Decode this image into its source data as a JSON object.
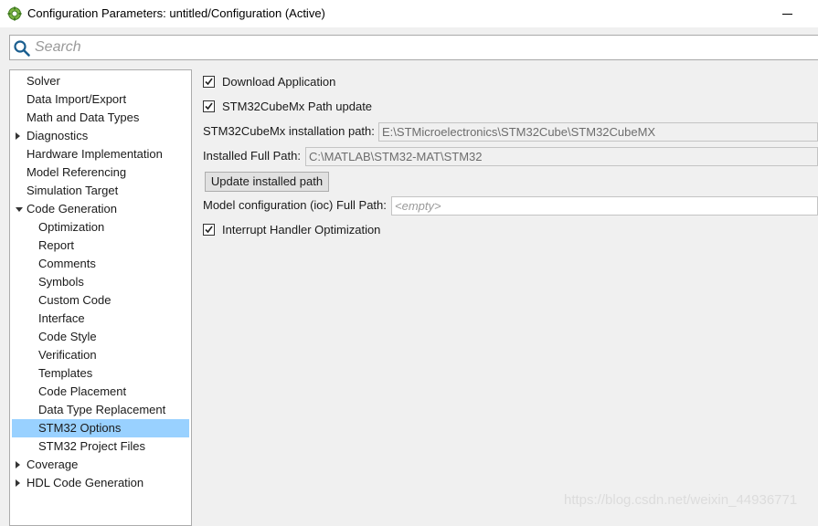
{
  "window": {
    "title": "Configuration Parameters: untitled/Configuration (Active)"
  },
  "search": {
    "placeholder": "Search"
  },
  "tree": {
    "items": [
      {
        "label": "Solver",
        "level": 0,
        "expander": "none"
      },
      {
        "label": "Data Import/Export",
        "level": 0,
        "expander": "none"
      },
      {
        "label": "Math and Data Types",
        "level": 0,
        "expander": "none"
      },
      {
        "label": "Diagnostics",
        "level": 0,
        "expander": "collapsed"
      },
      {
        "label": "Hardware Implementation",
        "level": 0,
        "expander": "none"
      },
      {
        "label": "Model Referencing",
        "level": 0,
        "expander": "none"
      },
      {
        "label": "Simulation Target",
        "level": 0,
        "expander": "none"
      },
      {
        "label": "Code Generation",
        "level": 0,
        "expander": "expanded"
      },
      {
        "label": "Optimization",
        "level": 1,
        "expander": "none"
      },
      {
        "label": "Report",
        "level": 1,
        "expander": "none"
      },
      {
        "label": "Comments",
        "level": 1,
        "expander": "none"
      },
      {
        "label": "Symbols",
        "level": 1,
        "expander": "none"
      },
      {
        "label": "Custom Code",
        "level": 1,
        "expander": "none"
      },
      {
        "label": "Interface",
        "level": 1,
        "expander": "none"
      },
      {
        "label": "Code Style",
        "level": 1,
        "expander": "none"
      },
      {
        "label": "Verification",
        "level": 1,
        "expander": "none"
      },
      {
        "label": "Templates",
        "level": 1,
        "expander": "none"
      },
      {
        "label": "Code Placement",
        "level": 1,
        "expander": "none"
      },
      {
        "label": "Data Type Replacement",
        "level": 1,
        "expander": "none"
      },
      {
        "label": "STM32 Options",
        "level": 1,
        "expander": "none",
        "selected": true
      },
      {
        "label": "STM32 Project Files",
        "level": 1,
        "expander": "none"
      },
      {
        "label": "Coverage",
        "level": 0,
        "expander": "collapsed"
      },
      {
        "label": "HDL Code Generation",
        "level": 0,
        "expander": "collapsed"
      }
    ]
  },
  "options": {
    "download_application": {
      "label": "Download Application",
      "checked": true
    },
    "cubemx_path_update": {
      "label": "STM32CubeMx Path update",
      "checked": true
    },
    "cubemx_install_path": {
      "label": "STM32CubeMx installation path:",
      "value": "E:\\STMicroelectronics\\STM32Cube\\STM32CubeMX"
    },
    "installed_full_path": {
      "label": "Installed Full Path:",
      "value": "C:\\MATLAB\\STM32-MAT\\STM32"
    },
    "update_button": {
      "label": "Update installed path"
    },
    "ioc_full_path": {
      "label": "Model configuration (ioc) Full Path:",
      "placeholder": "<empty>"
    },
    "interrupt_handler_optimization": {
      "label": "Interrupt Handler Optimization",
      "checked": true
    }
  },
  "watermark": "https://blog.csdn.net/weixin_44936771",
  "colors": {
    "selection": "#99d1ff",
    "background": "#f0f0f0"
  }
}
